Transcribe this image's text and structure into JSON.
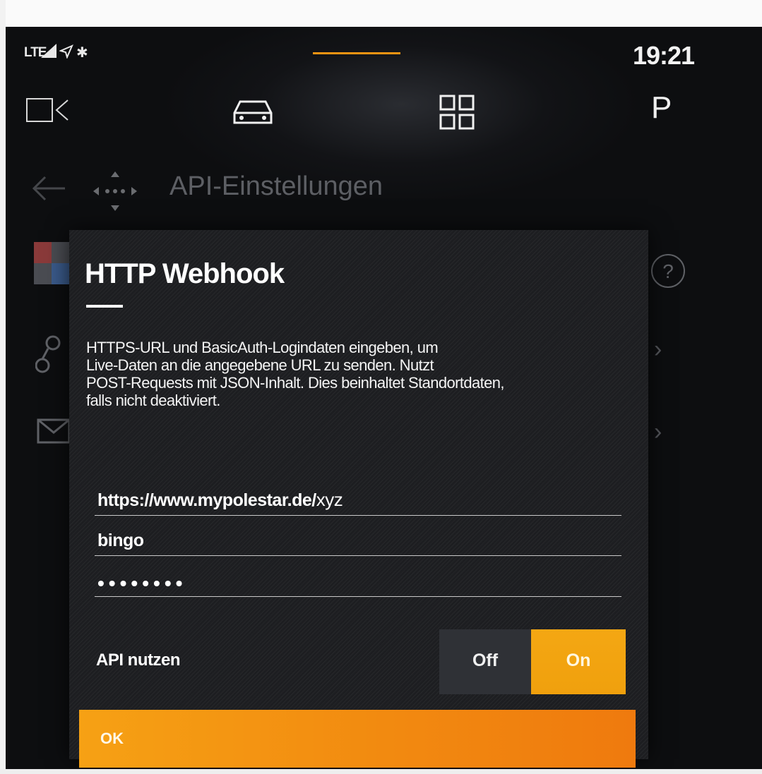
{
  "status_bar": {
    "network": "LTE",
    "time": "19:21"
  },
  "top_nav": {
    "items": [
      {
        "icon": "camera-icon"
      },
      {
        "icon": "car-icon"
      },
      {
        "icon": "apps-grid-icon"
      },
      {
        "label": "P"
      }
    ]
  },
  "header": {
    "title": "API-Einstellungen"
  },
  "dialog": {
    "title": "HTTP Webhook",
    "description": "HTTPS-URL und BasicAuth-Logindaten eingeben, um\nLive-Daten an die angegebene URL zu senden. Nutzt\nPOST-Requests mit JSON-Inhalt. Dies beinhaltet Standortdaten,\nfalls nicht deaktiviert.",
    "url_value": "https://www.mypolestar.de/",
    "url_suffix": "xyz",
    "username_value": "bingo",
    "password_masked": "••••••••",
    "toggle": {
      "label": "API nutzen",
      "off_label": "Off",
      "on_label": "On",
      "selected": "On"
    },
    "ok_label": "OK"
  },
  "colors": {
    "accent": "#f39412",
    "screen_bg": "#0d0e10",
    "dialog_bg": "#1d1e21",
    "toggle_off_bg": "#2f3136",
    "toggle_on_bg": "#f4a713"
  }
}
